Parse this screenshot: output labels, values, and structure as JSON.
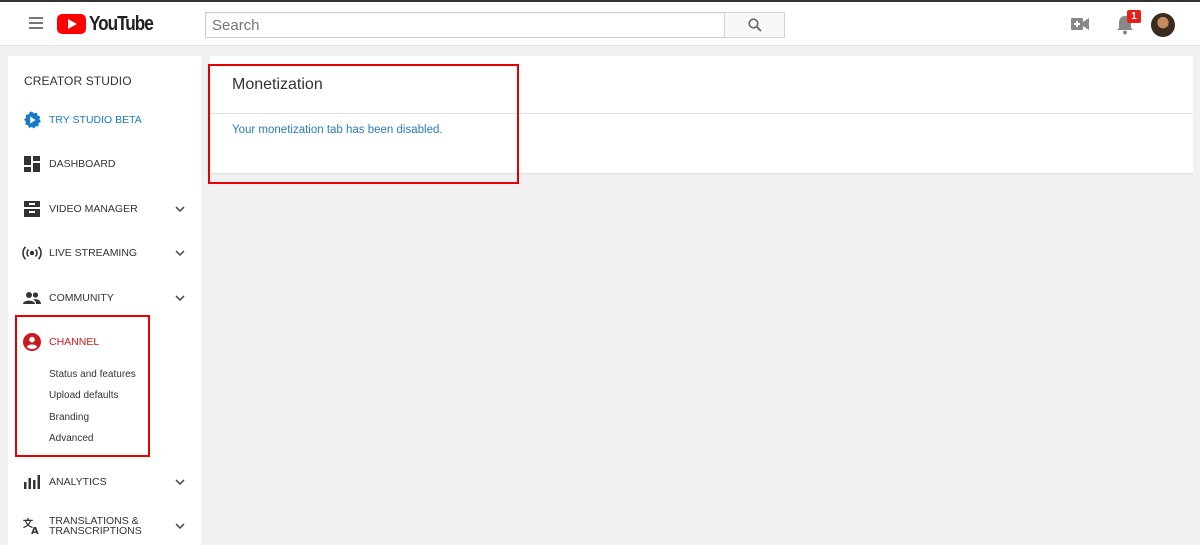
{
  "header": {
    "logo_text": "YouTube",
    "search_placeholder": "Search",
    "notification_count": "1",
    "brand_color": "#ff0000",
    "icons": [
      "hamburger-menu-icon",
      "search-icon",
      "create-video-icon",
      "notification-bell-icon"
    ]
  },
  "sidebar": {
    "title": "CREATOR STUDIO",
    "items": [
      {
        "label": "TRY STUDIO BETA",
        "icon": "gear-icon",
        "color": "#167ac6"
      },
      {
        "label": "DASHBOARD",
        "icon": "dashboard-icon"
      },
      {
        "label": "VIDEO MANAGER",
        "icon": "video-manager-icon",
        "expandable": true
      },
      {
        "label": "LIVE STREAMING",
        "icon": "live-streaming-icon",
        "expandable": true
      },
      {
        "label": "COMMUNITY",
        "icon": "community-icon",
        "expandable": true
      },
      {
        "label": "CHANNEL",
        "icon": "account-circle-icon",
        "active": true,
        "color": "#cc181e"
      },
      {
        "label": "ANALYTICS",
        "icon": "analytics-icon",
        "expandable": true
      },
      {
        "label": "TRANSLATIONS &",
        "label2": "TRANSCRIPTIONS",
        "icon": "translate-icon",
        "expandable": true
      }
    ],
    "channel_subitems": [
      "Status and features",
      "Upload defaults",
      "Branding",
      "Advanced"
    ]
  },
  "main": {
    "title": "Monetization",
    "message": "Your monetization tab has been disabled.",
    "message_color": "#2b7bb9",
    "highlight_color": "#e60000"
  }
}
